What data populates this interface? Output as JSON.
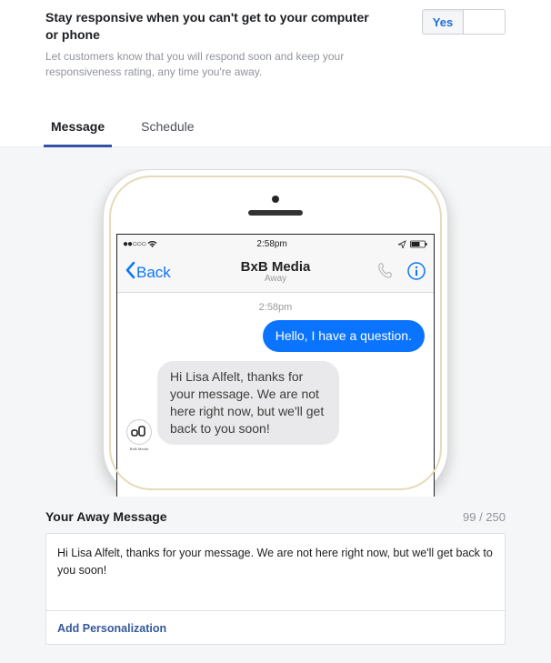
{
  "header": {
    "title": "Stay responsive when you can't get to your computer or phone",
    "description": "Let customers know that you will respond soon and keep your responsiveness rating, any time you're away."
  },
  "toggle": {
    "yes_label": "Yes",
    "no_label": ""
  },
  "tabs": {
    "message": "Message",
    "schedule": "Schedule"
  },
  "phone": {
    "status_time": "2:58pm",
    "nav_back": "Back",
    "nav_title": "BxB Media",
    "nav_subtitle": "Away",
    "chat_timestamp": "2:58pm",
    "incoming_message": "Hello, I have a question.",
    "reply_message": "Hi Lisa Alfelt, thanks for your message. We are not here right now, but we'll get back to you soon!",
    "avatar_text": "B",
    "avatar_caption": "BxB Media"
  },
  "away": {
    "label": "Your Away Message",
    "count_current": "99",
    "count_max": "250",
    "text": "Hi Lisa Alfelt, thanks for your message. We are not here right now, but we'll get back to you soon!",
    "add_personalization": "Add Personalization"
  }
}
